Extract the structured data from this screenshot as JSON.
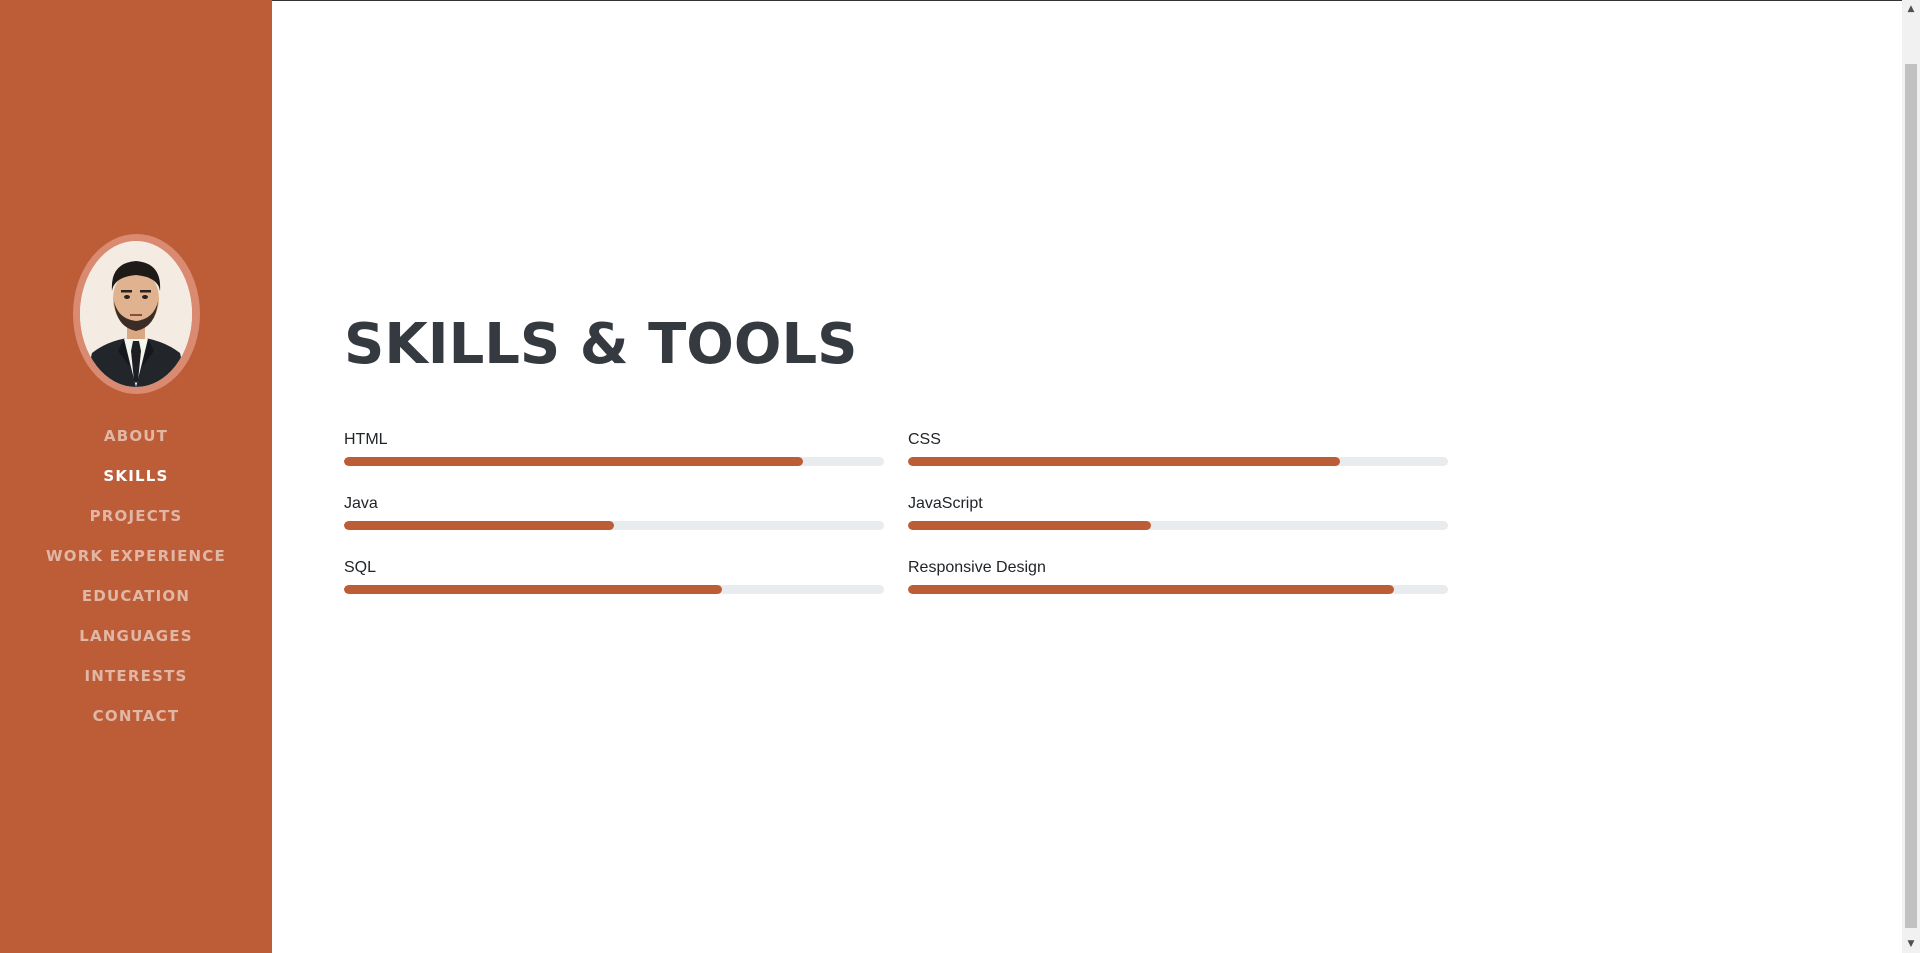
{
  "theme": {
    "sidebar_color": "#bd5d38",
    "bar_fill_color": "#bd5d38",
    "bar_track_color": "#e9ecef",
    "title_color": "#343a40"
  },
  "sidebar": {
    "avatar_icon": "profile-photo",
    "nav": [
      {
        "label": "ABOUT",
        "active": false
      },
      {
        "label": "SKILLS",
        "active": true
      },
      {
        "label": "PROJECTS",
        "active": false
      },
      {
        "label": "WORK EXPERIENCE",
        "active": false
      },
      {
        "label": "EDUCATION",
        "active": false
      },
      {
        "label": "LANGUAGES",
        "active": false
      },
      {
        "label": "INTERESTS",
        "active": false
      },
      {
        "label": "CONTACT",
        "active": false
      }
    ]
  },
  "main": {
    "title": "SKILLS & TOOLS",
    "skills": [
      {
        "name": "HTML",
        "level": 85
      },
      {
        "name": "CSS",
        "level": 80
      },
      {
        "name": "Java",
        "level": 50
      },
      {
        "name": "JavaScript",
        "level": 45
      },
      {
        "name": "SQL",
        "level": 70
      },
      {
        "name": "Responsive Design",
        "level": 90
      }
    ]
  },
  "scrollbar": {
    "up_icon": "chevron-up-icon",
    "down_icon": "chevron-down-icon"
  }
}
